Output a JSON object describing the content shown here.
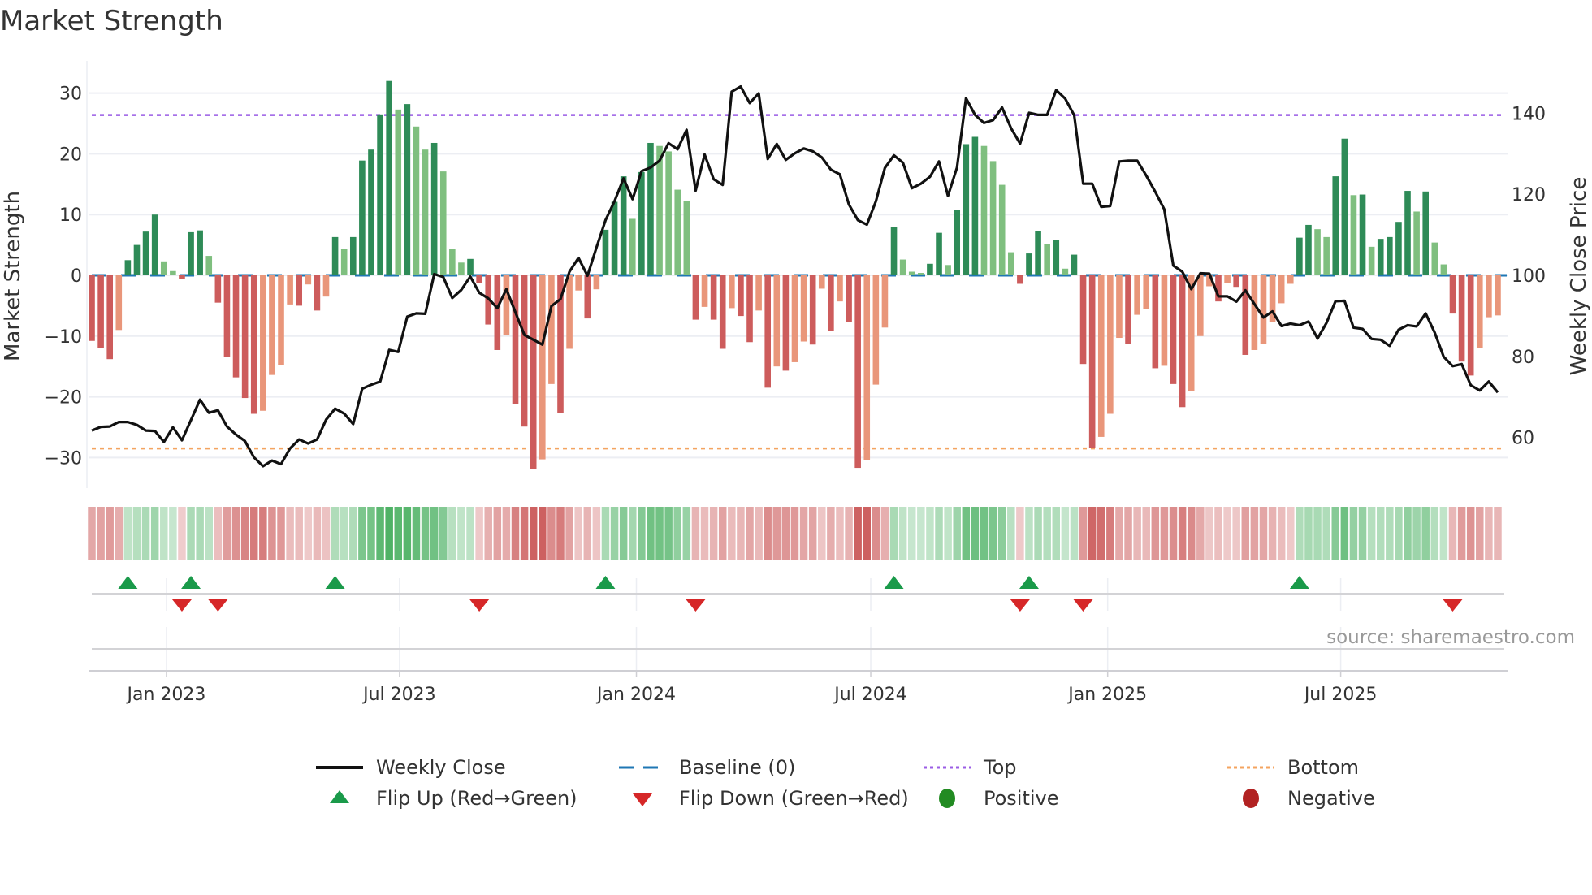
{
  "title": "Market Strength",
  "source": "source: sharemaestro.com",
  "chart_data": {
    "type": "bar",
    "title": "Market Strength",
    "x_start": "2022-11-04",
    "x_step_days": 7,
    "ylabel": "Market Strength",
    "y2label": "Weekly Close Price",
    "ylim": [
      -34.5,
      34.5
    ],
    "y2lim": [
      48.3,
      151.7
    ],
    "yticks": [
      -30,
      -20,
      -10,
      0,
      10,
      20,
      30
    ],
    "ytick_labels": [
      "−30",
      "−20",
      "−10",
      "0",
      "10",
      "20",
      "30"
    ],
    "y2ticks": [
      60,
      80,
      100,
      120,
      140
    ],
    "y2tick_labels": [
      "60",
      "80",
      "100",
      "120",
      "140"
    ],
    "xticks": [
      {
        "date": "2023-01-01",
        "label": "Jan 2023"
      },
      {
        "date": "2023-07-01",
        "label": "Jul 2023"
      },
      {
        "date": "2024-01-01",
        "label": "Jan 2024"
      },
      {
        "date": "2024-07-01",
        "label": "Jul 2024"
      },
      {
        "date": "2025-01-01",
        "label": "Jan 2025"
      },
      {
        "date": "2025-07-01",
        "label": "Jul 2025"
      }
    ],
    "grid": true,
    "top_level": 26.4,
    "bottom_level": -28.5,
    "baseline": 0,
    "strength": [
      -10.8,
      -12,
      -13.8,
      -9,
      2.5,
      5,
      7.2,
      10,
      2.3,
      0.7,
      -0.6,
      7.1,
      7.4,
      3.2,
      -4.5,
      -13.5,
      -16.8,
      -20.2,
      -22.8,
      -22.3,
      -16.4,
      -14.8,
      -4.8,
      -5,
      -1.5,
      -5.8,
      -3.5,
      6.3,
      4.3,
      6.3,
      18.9,
      20.7,
      26.5,
      32,
      27.3,
      28.2,
      24.5,
      20.7,
      21.8,
      17.1,
      4.4,
      2.1,
      2.7,
      -1.3,
      -8.1,
      -12.3,
      -9.9,
      -21.2,
      -24.9,
      -31.9,
      -30.3,
      -17.9,
      -22.7,
      -12.1,
      -2.5,
      -7.1,
      -2.3,
      7.5,
      12.1,
      16.3,
      9.3,
      17,
      21.8,
      21.3,
      20.4,
      14.1,
      12.2,
      -7.3,
      -5.2,
      -7.3,
      -12.1,
      -5.4,
      -6.7,
      -11,
      -5.8,
      -18.5,
      -15,
      -15.7,
      -14.3,
      -10.9,
      -11.4,
      -2.2,
      -9.2,
      -4.3,
      -7.7,
      -31.7,
      -30.4,
      -18,
      -8.6,
      7.9,
      2.6,
      0.6,
      0.4,
      1.9,
      7,
      1.7,
      10.8,
      21.6,
      22.8,
      21.3,
      18.8,
      14.9,
      3.8,
      -1.4,
      3.6,
      7.3,
      5.1,
      5.8,
      1.1,
      3.4,
      -14.6,
      -28.4,
      -26.6,
      -22.8,
      -10.3,
      -11.3,
      -6.5,
      -5.6,
      -15.3,
      -14.9,
      -17.9,
      -21.7,
      -19.1,
      -10,
      -1.8,
      -4.3,
      -1.3,
      -1.9,
      -13.1,
      -12.3,
      -11.3,
      -7.7,
      -4.6,
      -1.4,
      6.2,
      8.3,
      7.6,
      6.3,
      16.3,
      22.5,
      13.2,
      13.3,
      4.7,
      6,
      6.3,
      8.8,
      13.9,
      10.5,
      13.8,
      5.4,
      1.8,
      -6.3,
      -14.2,
      -16.5,
      -11.9,
      -6.9,
      -6.6
    ],
    "weekly_close": [
      61.7,
      62.6,
      62.7,
      63.8,
      63.8,
      63.1,
      61.7,
      61.6,
      58.9,
      62.5,
      59.3,
      64.3,
      69.3,
      66.1,
      66.7,
      62.7,
      60.7,
      59.1,
      55.1,
      52.9,
      54.3,
      53.4,
      57.3,
      59.5,
      58.5,
      59.5,
      64.4,
      67.1,
      65.9,
      63.3,
      72,
      73,
      73.8,
      81.6,
      81.1,
      89.8,
      90.6,
      90.5,
      100.3,
      99.6,
      94.4,
      96.4,
      99.7,
      95.7,
      94.3,
      91.9,
      96.6,
      90.9,
      85.3,
      84.1,
      82.9,
      92.4,
      94.1,
      100.9,
      104.3,
      99.9,
      106.9,
      113.6,
      118.3,
      123.9,
      118.8,
      125.7,
      126.6,
      128.3,
      132.6,
      131.1,
      135.9,
      120.9,
      129.8,
      123.7,
      122.3,
      145.3,
      146.6,
      142.5,
      144.9,
      128.7,
      132.4,
      128.5,
      130.1,
      131.3,
      130.6,
      129.1,
      126.1,
      124.9,
      117.5,
      113.6,
      112.5,
      118.3,
      126.5,
      129.6,
      127.8,
      121.5,
      122.6,
      124.3,
      128.1,
      119.6,
      126.6,
      143.7,
      139.6,
      137.6,
      138.3,
      141.4,
      136.3,
      132.5,
      140.1,
      139.6,
      139.6,
      145.7,
      143.6,
      139.5,
      122.6,
      122.6,
      116.9,
      117.1,
      128.1,
      128.3,
      128.3,
      124.6,
      120.6,
      116.3,
      102.4,
      100.9,
      96.6,
      100.5,
      100.4,
      94.8,
      94.8,
      93.5,
      96.3,
      92.9,
      89.6,
      91.1,
      87.5,
      88.1,
      87.7,
      88.6,
      84.4,
      88.3,
      93.6,
      93.7,
      87.1,
      86.8,
      84.3,
      84.1,
      82.6,
      86.6,
      87.7,
      87.4,
      90.6,
      85.9,
      79.9,
      77.6,
      78.1,
      72.9,
      71.6,
      73.8,
      71.1
    ],
    "legend_position": "bottom",
    "legend": [
      {
        "key": "weekly_close",
        "label": "Weekly Close"
      },
      {
        "key": "baseline",
        "label": "Baseline (0)"
      },
      {
        "key": "top",
        "label": "Top"
      },
      {
        "key": "bottom",
        "label": "Bottom"
      },
      {
        "key": "flip_up",
        "label": "Flip Up (Red→Green)"
      },
      {
        "key": "flip_down",
        "label": "Flip Down (Green→Red)"
      },
      {
        "key": "positive",
        "label": "Positive"
      },
      {
        "key": "negative",
        "label": "Negative"
      }
    ]
  },
  "colors": {
    "pos_strong": "#2e8b57",
    "pos_weak": "#7fbf7f",
    "neg_strong": "#cd5c5c",
    "neg_weak": "#e9967a",
    "close": "#111111",
    "baseline": "#1f77b4",
    "top": "#9b5de5",
    "bottom": "#f4a460",
    "flip_up": "#1a9a4a",
    "flip_down": "#d62728",
    "positive": "#228b22",
    "negative": "#b22222",
    "grid": "#eceef3"
  }
}
